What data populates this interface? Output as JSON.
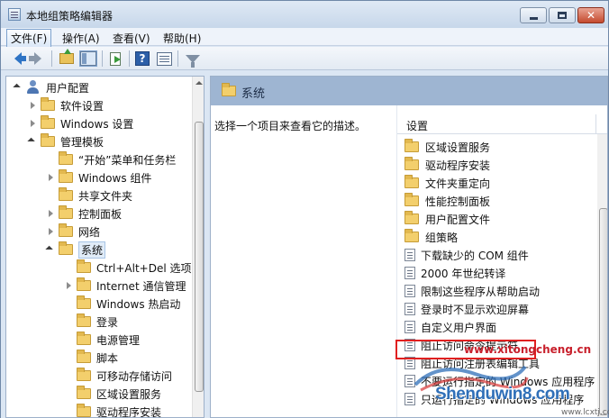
{
  "window": {
    "title": "本地组策略编辑器"
  },
  "menu": [
    "文件(F)",
    "操作(A)",
    "查看(V)",
    "帮助(H)"
  ],
  "toolbar_icons": [
    "back-arrow-icon",
    "forward-arrow-icon",
    "up-folder-icon",
    "show-hide-tree-icon",
    "export-list-icon",
    "help-icon",
    "properties-icon",
    "filter-icon"
  ],
  "tree": [
    {
      "label": "用户配置",
      "icon": "user-icon",
      "state": "expanded"
    },
    {
      "label": "软件设置",
      "icon": "folder-icon",
      "state": "collapsed"
    },
    {
      "label": "Windows 设置",
      "icon": "folder-icon",
      "state": "collapsed"
    },
    {
      "label": "管理模板",
      "icon": "folder-icon",
      "state": "expanded"
    },
    {
      "label": "“开始”菜单和任务栏",
      "icon": "folder-icon",
      "state": "none"
    },
    {
      "label": "Windows 组件",
      "icon": "folder-icon",
      "state": "collapsed"
    },
    {
      "label": "共享文件夹",
      "icon": "folder-icon",
      "state": "none"
    },
    {
      "label": "控制面板",
      "icon": "folder-icon",
      "state": "collapsed"
    },
    {
      "label": "网络",
      "icon": "folder-icon",
      "state": "collapsed"
    },
    {
      "label": "系统",
      "icon": "folder-icon",
      "state": "expanded",
      "selected": true
    },
    {
      "label": "Ctrl+Alt+Del 选项",
      "icon": "folder-icon",
      "state": "none"
    },
    {
      "label": "Internet 通信管理",
      "icon": "folder-icon",
      "state": "collapsed"
    },
    {
      "label": "Windows 热启动",
      "icon": "folder-icon",
      "state": "none"
    },
    {
      "label": "登录",
      "icon": "folder-icon",
      "state": "none"
    },
    {
      "label": "电源管理",
      "icon": "folder-icon",
      "state": "none"
    },
    {
      "label": "脚本",
      "icon": "folder-icon",
      "state": "none"
    },
    {
      "label": "可移动存储访问",
      "icon": "folder-icon",
      "state": "none"
    },
    {
      "label": "区域设置服务",
      "icon": "folder-icon",
      "state": "none"
    },
    {
      "label": "驱动程序安装",
      "icon": "folder-icon",
      "state": "none"
    }
  ],
  "right": {
    "header_title": "系统",
    "description": "选择一个项目来查看它的描述。",
    "column_header": "设置",
    "items": [
      {
        "label": "区域设置服务",
        "icon": "folder-icon"
      },
      {
        "label": "驱动程序安装",
        "icon": "folder-icon"
      },
      {
        "label": "文件夹重定向",
        "icon": "folder-icon"
      },
      {
        "label": "性能控制面板",
        "icon": "folder-icon"
      },
      {
        "label": "用户配置文件",
        "icon": "folder-icon"
      },
      {
        "label": "组策略",
        "icon": "folder-icon"
      },
      {
        "label": "下载缺少的 COM 组件",
        "icon": "policy-setting-icon"
      },
      {
        "label": "2000 年世纪转译",
        "icon": "policy-setting-icon"
      },
      {
        "label": "限制这些程序从帮助启动",
        "icon": "policy-setting-icon"
      },
      {
        "label": "登录时不显示欢迎屏幕",
        "icon": "policy-setting-icon"
      },
      {
        "label": "自定义用户界面",
        "icon": "policy-setting-icon"
      },
      {
        "label": "阻止访问命令提示符",
        "icon": "policy-setting-icon",
        "highlighted": true
      },
      {
        "label": "阻止访问注册表编辑工具",
        "icon": "policy-setting-icon"
      },
      {
        "label": "不要运行指定的 Windows 应用程序",
        "icon": "policy-setting-icon"
      },
      {
        "label": "只运行指定的 Windows 应用程序",
        "icon": "policy-setting-icon"
      }
    ]
  },
  "watermark": {
    "url": "www.xitongcheng.cn",
    "brand": "Shenduwin8.com",
    "sub": "www.lcxtj.com"
  },
  "scroll": {
    "tree_vertical_fraction": 0.55,
    "list_vertical_fraction": 0.72
  }
}
